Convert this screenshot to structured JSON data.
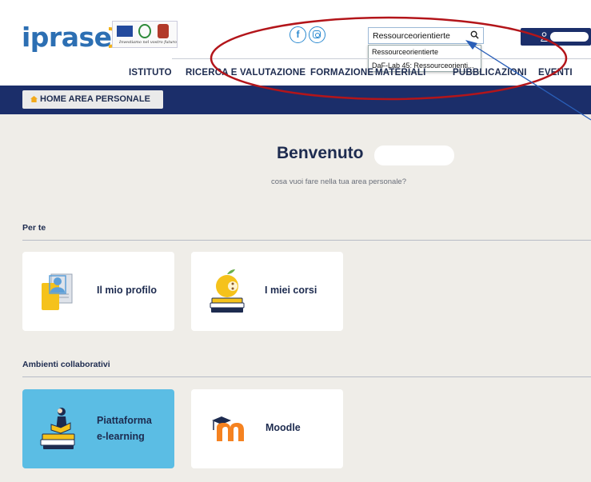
{
  "header": {
    "logo_text": "iprase",
    "eu_motto": "Investiamo nel vostro futuro",
    "social": {
      "facebook_glyph": "f"
    },
    "search": {
      "value": "Ressourceorientierte",
      "suggestions": [
        "Ressourceorientierte",
        "DaF-Lab 45: Ressourceorienti..."
      ]
    }
  },
  "nav": {
    "items": [
      "ISTITUTO",
      "RICERCA E VALUTAZIONE",
      "FORMAZIONE",
      "MATERIALI",
      "PUBBLICAZIONI",
      "EVENTI"
    ]
  },
  "bluebar": {
    "home_label": "HOME AREA PERSONALE"
  },
  "main": {
    "welcome": "Benvenuto",
    "subtitle": "cosa vuoi fare nella tua area personale?",
    "sections": [
      {
        "title": "Per te",
        "cards": [
          {
            "label": "Il mio profilo",
            "icon": "profile-card-icon"
          },
          {
            "label": "I miei corsi",
            "icon": "apple-books-icon"
          }
        ]
      },
      {
        "title": "Ambienti collaborativi",
        "cards": [
          {
            "label_line1": "Piattaforma",
            "label_line2": "e-learning",
            "icon": "reader-on-books-icon",
            "active": true
          },
          {
            "label": "Moodle",
            "icon": "moodle-logo-icon"
          }
        ]
      }
    ]
  },
  "colors": {
    "navy": "#1b2e6a",
    "logo_blue": "#2c6fb3",
    "card_active": "#5bbde4",
    "background": "#efede8",
    "annotation_red": "#b3151a",
    "annotation_arrow": "#2a5fb8"
  }
}
